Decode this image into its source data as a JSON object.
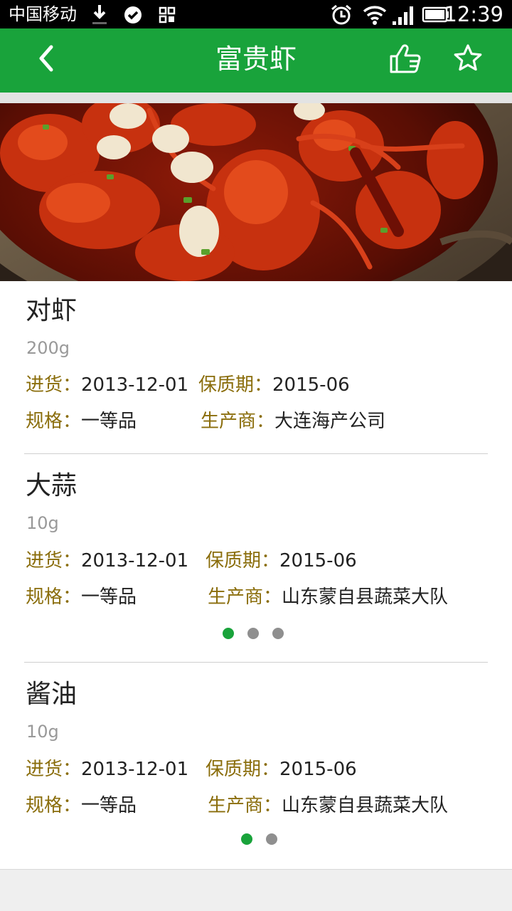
{
  "status_bar": {
    "carrier": "中国移动",
    "time": "12:39",
    "icons": [
      "download-icon",
      "check-circle-icon",
      "grid-app-icon",
      "alarm-icon",
      "wifi-icon",
      "signal-icon",
      "battery-icon"
    ]
  },
  "header": {
    "title": "富贵虾",
    "back_icon": "back-chevron-icon",
    "like_icon": "thumbs-up-icon",
    "favorite_icon": "star-icon"
  },
  "hero": {
    "image": "spicy-crayfish-dish"
  },
  "items": [
    {
      "name": "对虾",
      "qty": "200g",
      "purchase_label": "进货：",
      "purchase_value": "2013-12-01",
      "shelf_label": "保质期：",
      "shelf_value": "2015-06",
      "grade_label": "规格：",
      "grade_value": "一等品",
      "maker_label": "生产商：",
      "maker_value": "大连海产公司"
    },
    {
      "name": "大蒜",
      "qty": "10g",
      "purchase_label": "进货：",
      "purchase_value": "2013-12-01",
      "shelf_label": "保质期：",
      "shelf_value": "2015-06",
      "grade_label": "规格：",
      "grade_value": "一等品",
      "maker_label": "生产商：",
      "maker_value": "山东蒙自县蔬菜大队",
      "pager": {
        "total": 3,
        "active": 1
      }
    },
    {
      "name": "酱油",
      "qty": "10g",
      "purchase_label": "进货：",
      "purchase_value": "2013-12-01",
      "shelf_label": "保质期：",
      "shelf_value": "2015-06",
      "grade_label": "规格：",
      "grade_value": "一等品",
      "maker_label": "生产商：",
      "maker_value": "山东蒙自县蔬菜大队",
      "pager": {
        "total": 2,
        "active": 1
      }
    }
  ],
  "colors": {
    "primary": "#19a33b",
    "label": "#8a6d0b",
    "text": "#222222",
    "muted": "#999999",
    "dot_inactive": "#8f8f8f"
  }
}
